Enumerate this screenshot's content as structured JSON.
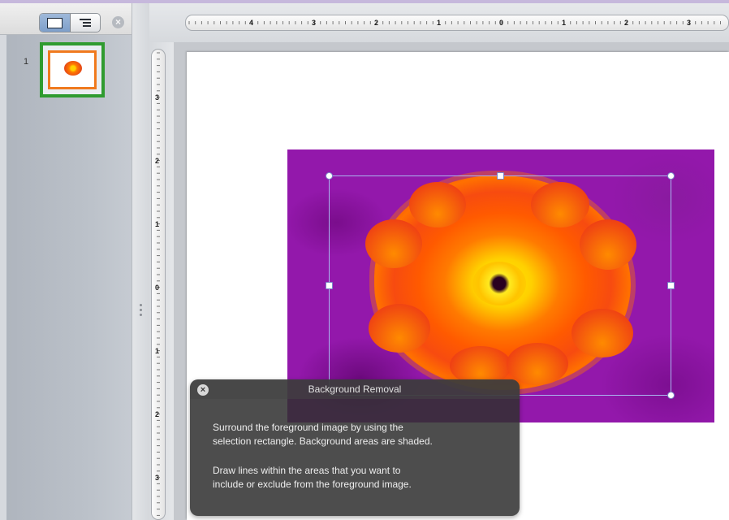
{
  "sidebar": {
    "slide_number": "1",
    "views": [
      "slides-view",
      "outline-view"
    ]
  },
  "ruler": {
    "horizontal_labels": [
      "4",
      "3",
      "2",
      "1",
      "0",
      "1",
      "2",
      "3"
    ],
    "vertical_labels": [
      "3",
      "2",
      "1",
      "0",
      "1",
      "2",
      "3"
    ]
  },
  "panel": {
    "title": "Background Removal",
    "paragraph1_line1": "Surround the foreground image by using the",
    "paragraph1_line2": "selection rectangle. Background areas are shaded.",
    "paragraph2_line1": "Draw lines within the areas that you want to",
    "paragraph2_line2": "include or exclude from the foreground image."
  },
  "colors": {
    "thumbnail_selection": "#2f9b2f",
    "thumbnail_border": "#f07a1e",
    "background_shading": "#9318ab"
  },
  "icons": {
    "toolbar_close": "close-icon",
    "panel_close": "close-icon"
  }
}
